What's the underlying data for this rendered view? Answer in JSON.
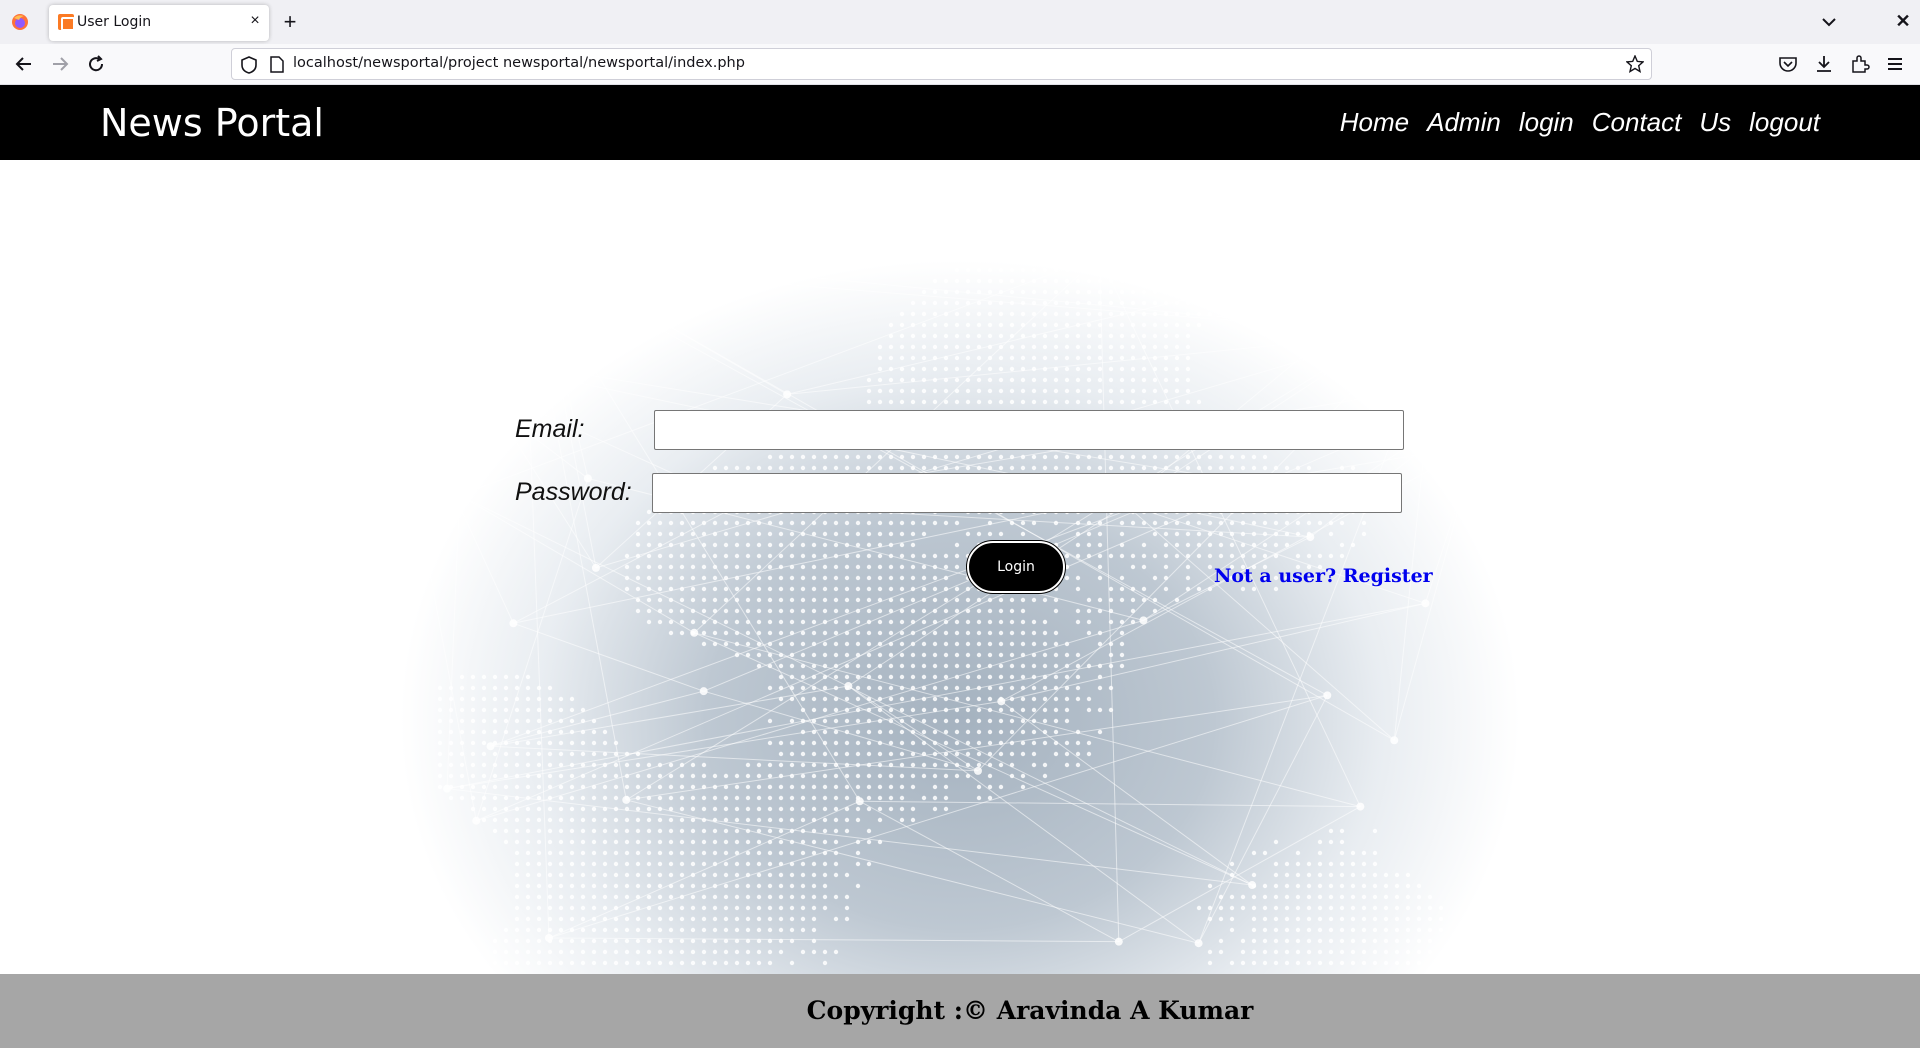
{
  "browser": {
    "tab_title": "User Login",
    "tab_close": "×",
    "new_tab": "+",
    "url": "localhost/newsportal/project newsportal/newsportal/index.php",
    "window_close": "✕"
  },
  "header": {
    "brand": "News Portal",
    "nav": [
      "Home",
      "Admin",
      "login",
      "Contact",
      "Us",
      "logout"
    ]
  },
  "form": {
    "email_label": "Email:",
    "email_value": "",
    "password_label": "Password:",
    "password_value": "",
    "login_label": "Login",
    "register_link": "Not a user? Register"
  },
  "footer": {
    "copyright": "Copyright :© Aravinda A Kumar"
  },
  "colors": {
    "header_bg": "#000000",
    "footer_bg": "#a6a6a6",
    "link": "#0000ee"
  }
}
